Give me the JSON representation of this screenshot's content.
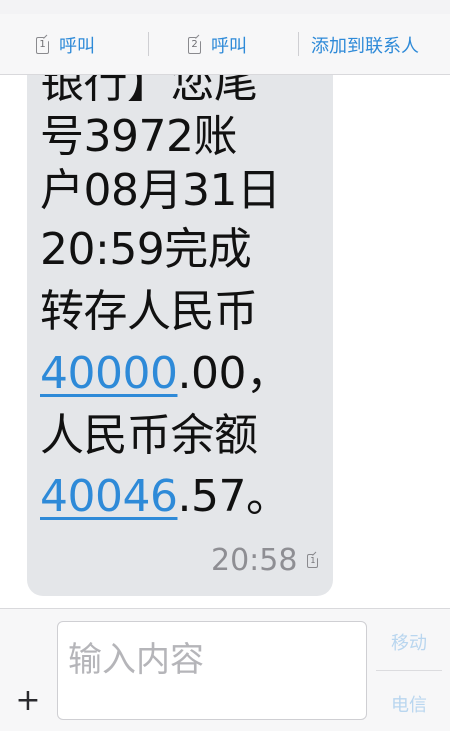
{
  "header": {
    "call_sim1": {
      "sim": "1",
      "label": "呼叫"
    },
    "call_sim2": {
      "sim": "2",
      "label": "呼叫"
    },
    "add_contact": "添加到联系人"
  },
  "message": {
    "lines": [
      {
        "text": "银行】您尾"
      },
      {
        "text": "号3972账"
      },
      {
        "text": "户08月31日"
      },
      {
        "text": "20:59完成"
      },
      {
        "text": "转存人民币"
      },
      {
        "link": "40000",
        "text": ".00，"
      },
      {
        "text": "人民币余额"
      },
      {
        "link": "40046",
        "text": ".57。"
      }
    ],
    "time": "20:58",
    "sim": "1"
  },
  "composer": {
    "placeholder": "输入内容",
    "add_label": "+",
    "send_mobile": "移动",
    "send_telecom": "电信"
  },
  "colors": {
    "accent": "#2e8ad8",
    "bubble": "#e4e6e9",
    "placeholder": "#b5b5b9",
    "disabled_send": "#b9d6ef"
  }
}
